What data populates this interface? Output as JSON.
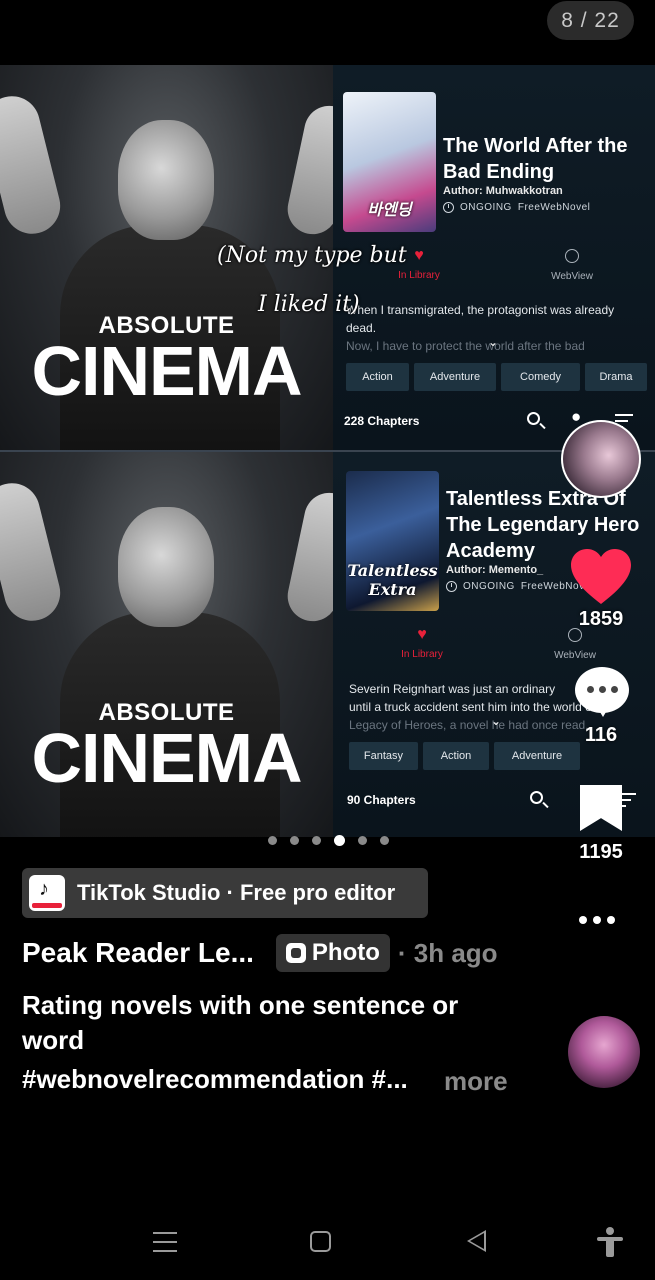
{
  "counter": "8 / 22",
  "meme": {
    "absolute": "ABSOLUTE",
    "cinema": "CINEMA"
  },
  "overlay": {
    "line1": "(Not my type but",
    "line2": "I liked it)"
  },
  "book1": {
    "title": "The World After the Bad Ending",
    "author": "Author: Muhwakkotran",
    "status": "ONGOING",
    "source": "FreeWebNovel",
    "cover_text": "바엔딩",
    "library_label": "In Library",
    "webview_label": "WebView",
    "desc_line1": "When I transmigrated, the protagonist was already",
    "desc_line2": "dead.",
    "desc_line3": "Now, I have to protect the world after the bad",
    "tags": [
      "Action",
      "Adventure",
      "Comedy",
      "Drama"
    ],
    "chapters": "228 Chapters"
  },
  "book2": {
    "title": "Talentless Extra Of The Legendary Hero Academy",
    "author": "Author: Memento_",
    "status": "ONGOING",
    "source": "FreeWebNovel",
    "cover_text": "Talentless Extra",
    "library_label": "In Library",
    "webview_label": "WebView",
    "desc_line1": "Severin Reignhart was just an ordinary",
    "desc_line2": "until a truck accident sent him into the world of",
    "desc_line3": "Legacy of Heroes, a novel he had once read.",
    "tags": [
      "Fantasy",
      "Action",
      "Adventure"
    ],
    "chapters": "90 Chapters"
  },
  "rail": {
    "likes": "1859",
    "comments": "116",
    "saves": "1195"
  },
  "carousel": {
    "total": 6,
    "active_index": 3
  },
  "studio": {
    "label": "TikTok Studio · Free pro editor"
  },
  "post": {
    "username": "Peak Reader Le...",
    "badge": "Photo",
    "time": "· 3h ago",
    "caption": "Rating novels with one sentence or word",
    "hashtags": "#webnovelrecommendation #...",
    "more": "more"
  },
  "colors": {
    "accent_red": "#e8213a",
    "tag_bg": "#1e3340",
    "background": "#000000"
  }
}
